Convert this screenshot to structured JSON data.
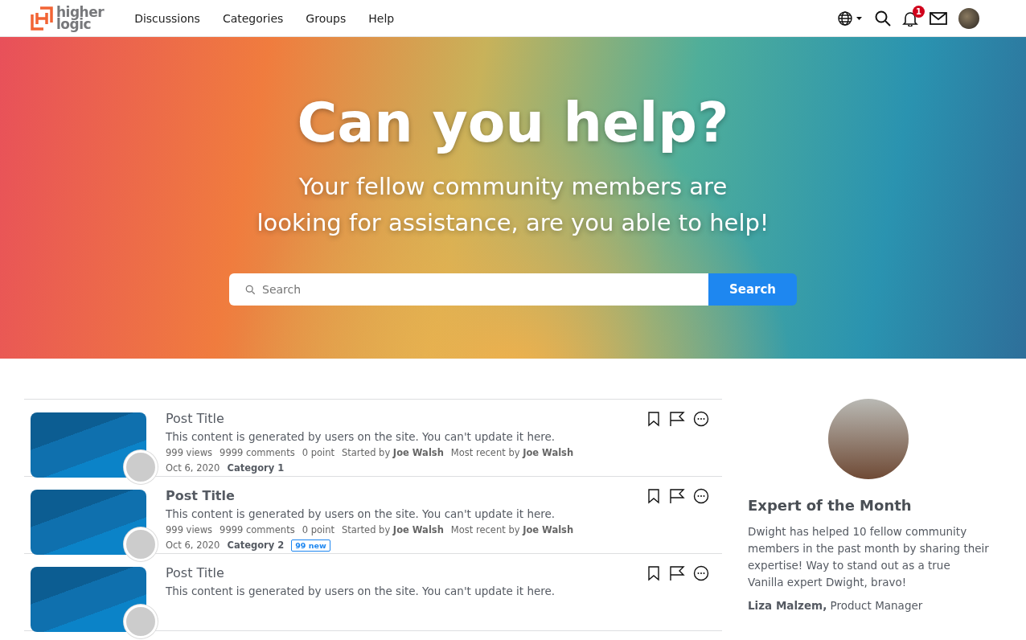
{
  "header": {
    "logo": {
      "line1": "higher",
      "line2": "logic"
    },
    "nav": [
      {
        "label": "Discussions"
      },
      {
        "label": "Categories"
      },
      {
        "label": "Groups"
      },
      {
        "label": "Help"
      }
    ],
    "notification_count": "1"
  },
  "hero": {
    "title": "Can you help?",
    "subtitle": "Your fellow community members are looking for assistance, are you able to help!",
    "search": {
      "placeholder": "Search",
      "button": "Search"
    }
  },
  "posts": [
    {
      "title": "Post Title",
      "unread": false,
      "excerpt": "This content is generated by users on the site. You can't update it here.",
      "meta": [
        "999 views",
        "9999 comments",
        "0 point",
        "Started by **Joe Walsh**",
        "Most recent by **Joe Walsh**"
      ],
      "date": "Oct 6, 2020",
      "category": "Category 1"
    },
    {
      "title": "Post Title",
      "unread": true,
      "excerpt": "This content is generated by users on the site. You can't update it here.",
      "meta": [
        "999 views",
        "9999 comments",
        "0 point",
        "Started by **Joe Walsh**",
        "Most recent by **Joe Walsh**"
      ],
      "date": "Oct 6, 2020",
      "category": "Category 2",
      "badge": "99 new"
    },
    {
      "title": "Post Title",
      "unread": false,
      "excerpt": "This content is generated by users on the site. You can't update it here."
    }
  ],
  "expert": {
    "title": "Expert of the Month",
    "text": "Dwight has helped 10 fellow community members in the past month by sharing their expertise! Way to stand out as a true Vanilla expert Dwight, bravo!",
    "author": "Liza Malzem,",
    "role": "Product Manager"
  }
}
